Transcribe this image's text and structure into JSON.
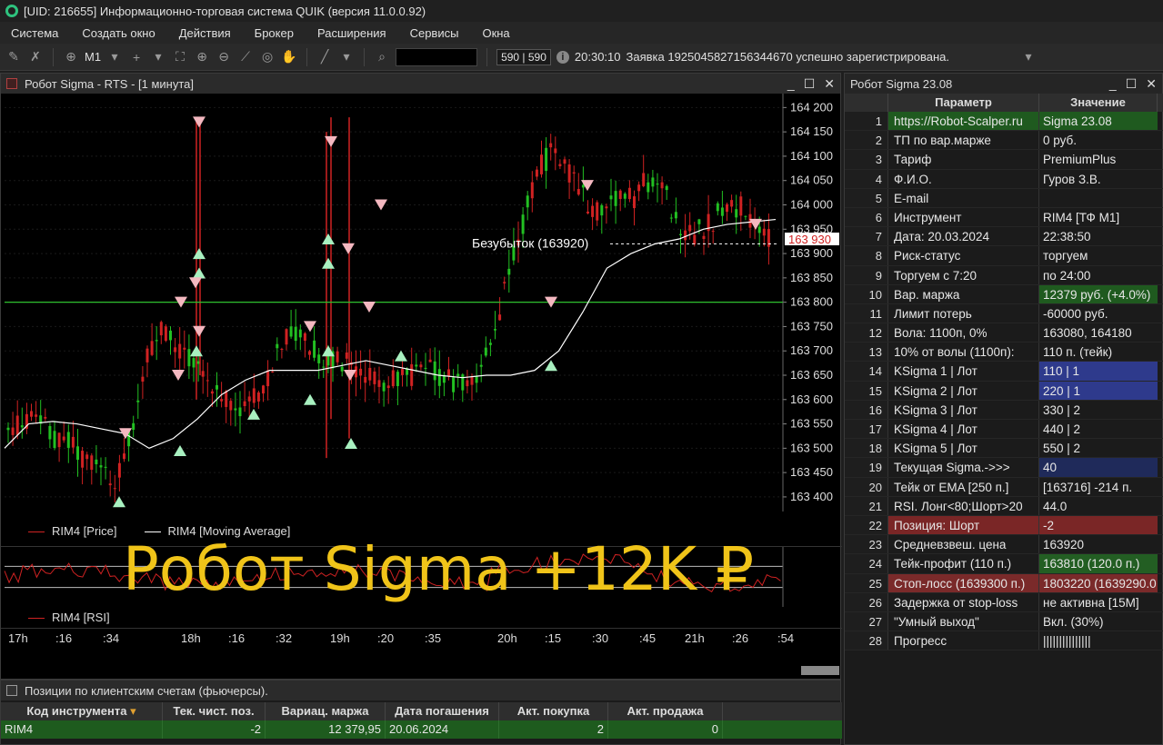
{
  "window": {
    "title": "[UID: 216655] Информационно-торговая система QUIK (версия 11.0.0.92)"
  },
  "menu": [
    "Система",
    "Создать окно",
    "Действия",
    "Брокер",
    "Расширения",
    "Сервисы",
    "Окна"
  ],
  "toolbar": {
    "interval": "M1",
    "counter": "590 | 590",
    "time": "20:30:10",
    "message": "Заявка 1925045827156344670 успешно зарегистрирована."
  },
  "chart_window": {
    "title": "Робот Sigma - RTS   - [1 минута]",
    "breakeven_label": "Безубыток (163920)",
    "current_price": "163 930",
    "y_ticks": [
      "164 200",
      "164 150",
      "164 100",
      "164 050",
      "164 000",
      "163 950",
      "163 900",
      "163 850",
      "163 800",
      "163 750",
      "163 700",
      "163 650",
      "163 600",
      "163 550",
      "163 500",
      "163 450",
      "163 400"
    ],
    "legend_price": "RIM4 [Price]",
    "legend_ma": "RIM4 [Moving Average]",
    "legend_rsi": "RIM4 [RSI]",
    "time_ticks": [
      "17h",
      ":16",
      ":34",
      "18h",
      ":16",
      ":32",
      "19h",
      ":20",
      ":35",
      "20h",
      ":15",
      ":30",
      ":45",
      "21h",
      ":26",
      ":54"
    ],
    "colors": {
      "up": "#22c022",
      "down": "#d02222",
      "ma": "#ffffff",
      "level": "#2ec02e"
    }
  },
  "chart_data": {
    "type": "candlestick",
    "ylim": [
      163370,
      164210
    ],
    "horizontal_level": 163800,
    "breakeven": 163920,
    "current": 163930,
    "ma": [
      163500,
      163550,
      163555,
      163550,
      163540,
      163530,
      163500,
      163520,
      163560,
      163610,
      163640,
      163660,
      163660,
      163660,
      163670,
      163680,
      163670,
      163660,
      163650,
      163645,
      163650,
      163650,
      163660,
      163700,
      163780,
      163870,
      163900,
      163920,
      163930,
      163950,
      163960,
      163965,
      163970
    ],
    "rsi_level_top": 70,
    "rsi_level_bottom": 30
  },
  "overlay": {
    "text": "Робот Sigma +12K ₽"
  },
  "positions": {
    "title": "Позиции по клиентским счетам (фьючерсы).",
    "columns": [
      "Код инструмента",
      "Тек. чист. поз.",
      "Вариац. маржа",
      "Дата погашения",
      "Акт. покупка",
      "Акт. продажа"
    ],
    "row": [
      "RIM4",
      "-2",
      "12 379,95",
      "20.06.2024",
      "2",
      "0"
    ]
  },
  "robot": {
    "title": "Робот Sigma 23.08",
    "col_param": "Параметр",
    "col_value": "Значение",
    "rows": [
      {
        "n": "1",
        "p": "https://Robot-Scalper.ru",
        "v": "Sigma 23.08"
      },
      {
        "n": "2",
        "p": "ТП по вар.марже",
        "v": "0 руб."
      },
      {
        "n": "3",
        "p": "Тариф",
        "v": "PremiumPlus"
      },
      {
        "n": "4",
        "p": "Ф.И.О.",
        "v": "Гуров З.В."
      },
      {
        "n": "5",
        "p": "E-mail",
        "v": ""
      },
      {
        "n": "6",
        "p": "Инструмент",
        "v": "RIM4 [ТФ M1]"
      },
      {
        "n": "7",
        "p": "Дата: 20.03.2024",
        "v": "22:38:50"
      },
      {
        "n": "8",
        "p": "Риск-статус",
        "v": "торгуем"
      },
      {
        "n": "9",
        "p": "Торгуем с 7:20",
        "v": "по 24:00"
      },
      {
        "n": "10",
        "p": "Вар. маржа",
        "v": "12379 руб. (+4.0%)"
      },
      {
        "n": "11",
        "p": "Лимит потерь",
        "v": "-60000 руб."
      },
      {
        "n": "12",
        "p": "Вола: 1100п, 0%",
        "v": "163080, 164180"
      },
      {
        "n": "13",
        "p": "10% от волы (1100п):",
        "v": "110 п. (тейк)"
      },
      {
        "n": "14",
        "p": "KSigma 1 | Лот",
        "v": "110 | 1"
      },
      {
        "n": "15",
        "p": "KSigma 2 | Лот",
        "v": "220 | 1"
      },
      {
        "n": "16",
        "p": "KSigma 3 | Лот",
        "v": "330 | 2"
      },
      {
        "n": "17",
        "p": "KSigma 4 | Лот",
        "v": "440 | 2"
      },
      {
        "n": "18",
        "p": "KSigma 5 | Лот",
        "v": "550 | 2"
      },
      {
        "n": "19",
        "p": "Текущая Sigma.->>>",
        "v": "40"
      },
      {
        "n": "20",
        "p": "Тейк от EMA [250 п.]",
        "v": "[163716] -214 п."
      },
      {
        "n": "21",
        "p": "RSI. Лонг<80;Шорт>20",
        "v": "44.0"
      },
      {
        "n": "22",
        "p": "Позиция: Шорт",
        "v": "-2"
      },
      {
        "n": "23",
        "p": "Средневзвеш. цена",
        "v": "163920"
      },
      {
        "n": "24",
        "p": "Тейк-профит (110 п.)",
        "v": "163810 (120.0 п.)"
      },
      {
        "n": "25",
        "p": "Стоп-лосс (1639300 п.)",
        "v": "1803220 (1639290.0"
      },
      {
        "n": "26",
        "p": "Задержка от stop-loss",
        "v": "не активна [15M]"
      },
      {
        "n": "27",
        "p": "\"Умный выход\"",
        "v": "Вкл. (30%)"
      },
      {
        "n": "28",
        "p": "Прогресс",
        "v": "|||||||||||||||"
      }
    ]
  }
}
